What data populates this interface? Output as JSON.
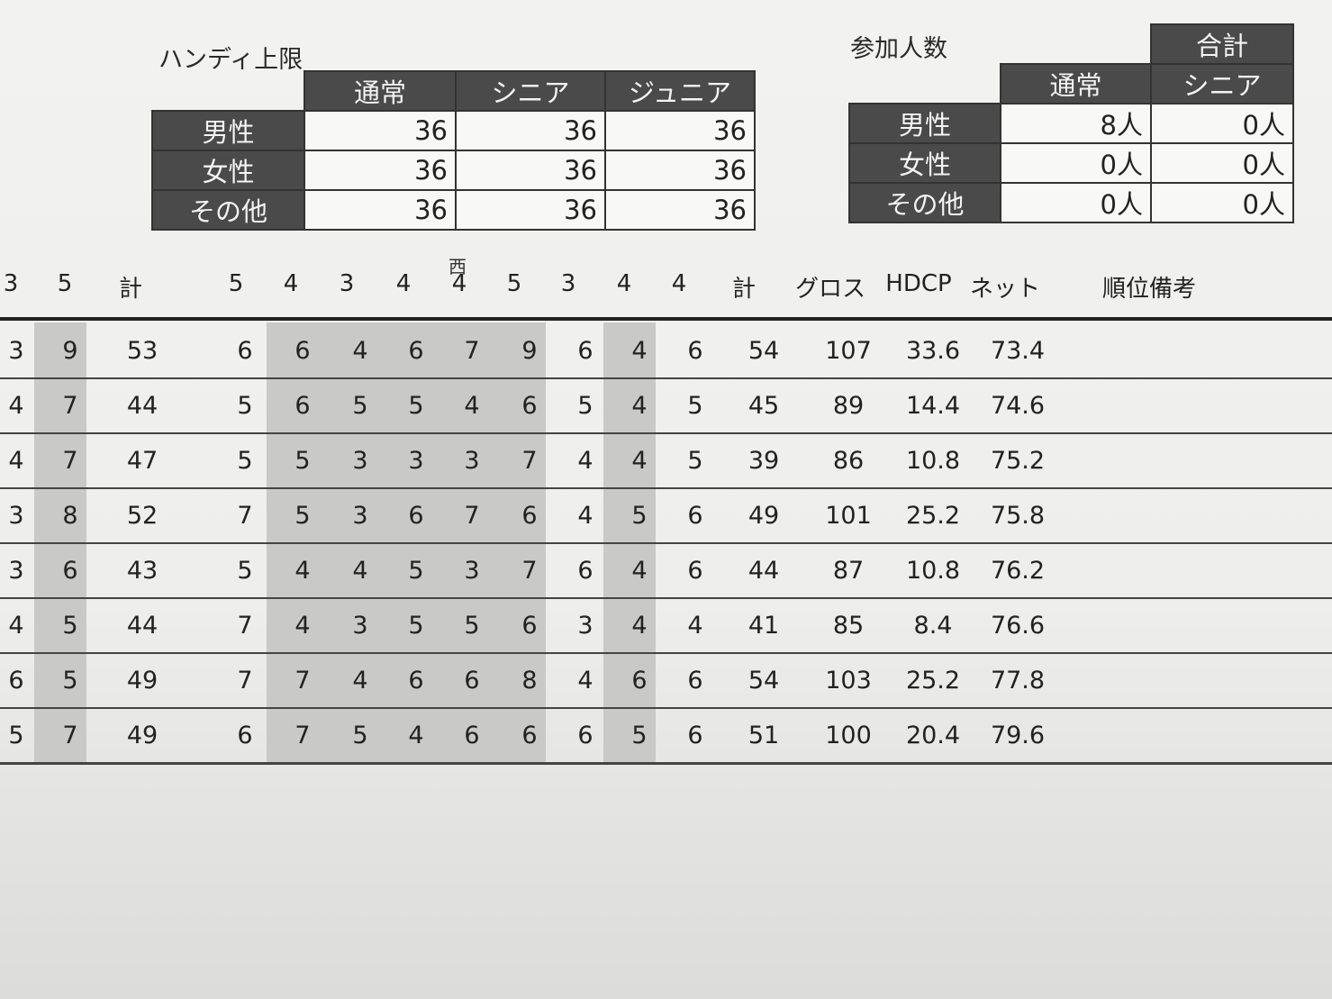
{
  "handicap": {
    "title": "ハンディ上限",
    "columns": [
      "通常",
      "シニア",
      "ジュニア"
    ],
    "rows": [
      {
        "label": "男性",
        "values": [
          "36",
          "36",
          "36"
        ]
      },
      {
        "label": "女性",
        "values": [
          "36",
          "36",
          "36"
        ]
      },
      {
        "label": "その他",
        "values": [
          "36",
          "36",
          "36"
        ]
      }
    ]
  },
  "participants": {
    "title": "参加人数",
    "group_label": "合計",
    "columns": [
      "通常",
      "シニア"
    ],
    "rows": [
      {
        "label": "男性",
        "values": [
          "8人",
          "0人"
        ]
      },
      {
        "label": "女性",
        "values": [
          "0人",
          "0人"
        ]
      },
      {
        "label": "その他",
        "values": [
          "0人",
          "0人"
        ]
      }
    ]
  },
  "score_sheet": {
    "section_label": "西",
    "header": [
      "3",
      "5",
      "計",
      "5",
      "4",
      "3",
      "4",
      "4",
      "5",
      "3",
      "4",
      "4",
      "計",
      "グロス",
      "HDCP",
      "ネット",
      "順位備考"
    ],
    "rows": [
      [
        "3",
        "9",
        "53",
        "6",
        "6",
        "4",
        "6",
        "7",
        "9",
        "6",
        "4",
        "6",
        "54",
        "107",
        "33.6",
        "73.4"
      ],
      [
        "4",
        "7",
        "44",
        "5",
        "6",
        "5",
        "5",
        "4",
        "6",
        "5",
        "4",
        "5",
        "45",
        "89",
        "14.4",
        "74.6"
      ],
      [
        "4",
        "7",
        "47",
        "5",
        "5",
        "3",
        "3",
        "3",
        "7",
        "4",
        "4",
        "5",
        "39",
        "86",
        "10.8",
        "75.2"
      ],
      [
        "3",
        "8",
        "52",
        "7",
        "5",
        "3",
        "6",
        "7",
        "6",
        "4",
        "5",
        "6",
        "49",
        "101",
        "25.2",
        "75.8"
      ],
      [
        "3",
        "6",
        "43",
        "5",
        "4",
        "4",
        "5",
        "3",
        "7",
        "6",
        "4",
        "6",
        "44",
        "87",
        "10.8",
        "76.2"
      ],
      [
        "4",
        "5",
        "44",
        "7",
        "4",
        "3",
        "5",
        "5",
        "6",
        "3",
        "4",
        "4",
        "41",
        "85",
        "8.4",
        "76.6"
      ],
      [
        "6",
        "5",
        "49",
        "7",
        "7",
        "4",
        "6",
        "6",
        "8",
        "4",
        "6",
        "6",
        "54",
        "103",
        "25.2",
        "77.8"
      ],
      [
        "5",
        "7",
        "49",
        "6",
        "7",
        "5",
        "4",
        "6",
        "6",
        "6",
        "5",
        "6",
        "51",
        "100",
        "20.4",
        "79.6"
      ]
    ]
  }
}
